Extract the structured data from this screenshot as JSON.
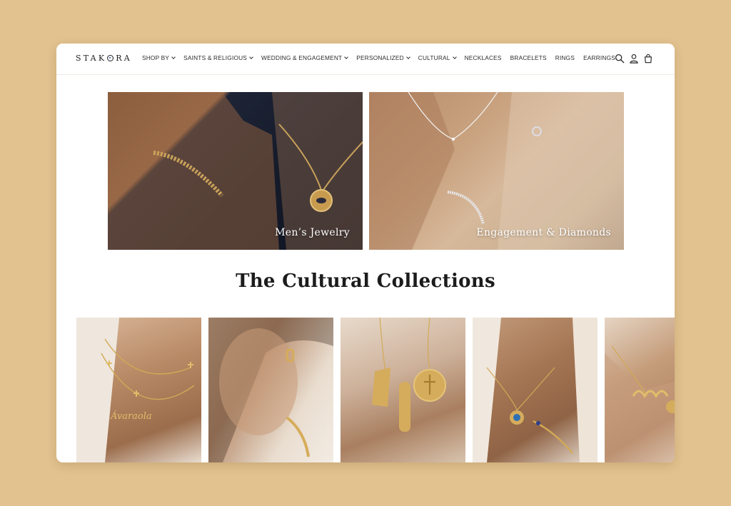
{
  "brand": {
    "logo_text": "STAKORA"
  },
  "nav": [
    {
      "label": "SHOP BY",
      "dropdown": true
    },
    {
      "label": "SAINTS & RELIGIOUS",
      "dropdown": true
    },
    {
      "label": "WEDDING & ENGAGEMENT",
      "dropdown": true
    },
    {
      "label": "PERSONALIZED",
      "dropdown": true
    },
    {
      "label": "CULTURAL",
      "dropdown": true
    },
    {
      "label": "NECKLACES",
      "dropdown": false
    },
    {
      "label": "BRACELETS",
      "dropdown": false
    },
    {
      "label": "RINGS",
      "dropdown": false
    },
    {
      "label": "EARRINGS",
      "dropdown": false
    }
  ],
  "header_icons": [
    "search-icon",
    "account-icon",
    "cart-icon"
  ],
  "heroes": [
    {
      "label": "Men’s Jewelry"
    },
    {
      "label": "Engagement & Diamonds"
    }
  ],
  "section": {
    "title": "The Cultural Collections"
  },
  "tiles": [
    {
      "alt": "name necklace with crosses"
    },
    {
      "alt": "gold earrings and bracelet"
    },
    {
      "alt": "Egyptian pendants"
    },
    {
      "alt": "evil eye necklace"
    },
    {
      "alt": "Arabic name necklace"
    }
  ],
  "colors": {
    "page_bg": "#e2c28f",
    "card_bg": "#ffffff",
    "text": "#1c1c1c"
  }
}
